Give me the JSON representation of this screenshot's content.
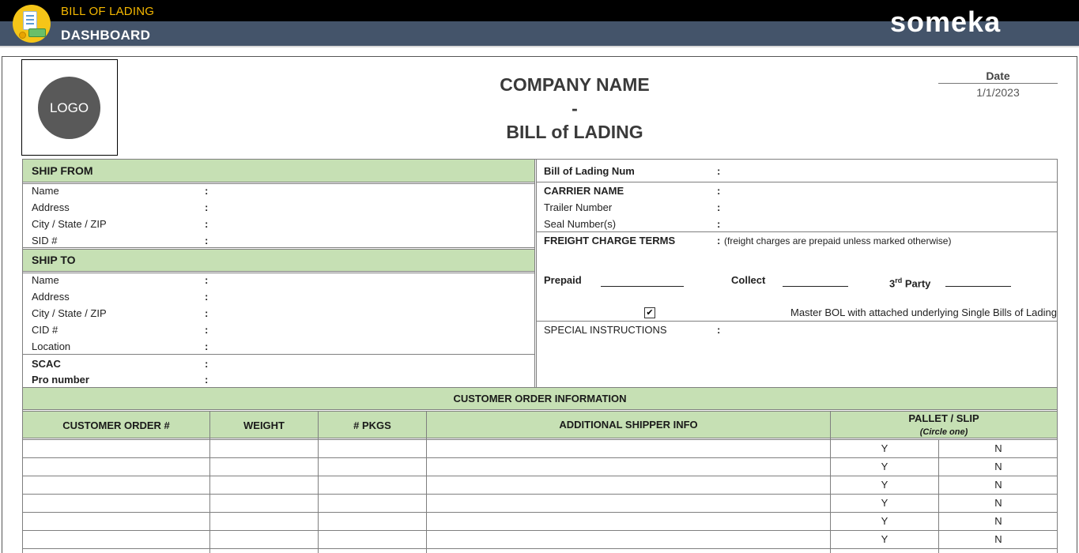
{
  "header": {
    "app_title": "BILL OF LADING",
    "section": "DASHBOARD",
    "brand": "someka"
  },
  "logo": {
    "text": "LOGO"
  },
  "document": {
    "company_name": "COMPANY NAME",
    "separator": "-",
    "doc_title": "BILL of LADING",
    "date_label": "Date",
    "date_value": "1/1/2023"
  },
  "ship_from": {
    "title": "SHIP FROM",
    "fields": [
      "Name",
      "Address",
      "City / State / ZIP",
      "SID #"
    ]
  },
  "ship_to": {
    "title": "SHIP TO",
    "fields": [
      "Name",
      "Address",
      "City / State / ZIP",
      "CID #",
      "Location"
    ],
    "scac": "SCAC",
    "pro_number": "Pro number"
  },
  "right_panel": {
    "bol_num": "Bill of Lading Num",
    "carrier_name": "CARRIER NAME",
    "trailer_number": "Trailer Number",
    "seal_numbers": "Seal Number(s)",
    "freight_terms": "FREIGHT CHARGE TERMS",
    "freight_note": "(freight charges are prepaid unless marked otherwise)",
    "prepaid": "Prepaid",
    "collect": "Collect",
    "third_party_num": "3",
    "third_party_sup": "rd",
    "third_party_word": "Party",
    "master_bol": "Master BOL with attached underlying Single Bills of Lading",
    "master_checked": "✔",
    "special_instructions": "SPECIAL INSTRUCTIONS"
  },
  "colon": ":",
  "orders": {
    "title": "CUSTOMER ORDER INFORMATION",
    "columns": [
      "CUSTOMER ORDER #",
      "WEIGHT",
      "# PKGS",
      "ADDITIONAL SHIPPER INFO",
      "PALLET / SLIP"
    ],
    "pallet_sub": "(Circle one)",
    "yes": "Y",
    "no": "N",
    "row_count": 6
  },
  "colors": {
    "header_top": "#000000",
    "header_band": "#44546a",
    "accent_yellow": "#f5b800",
    "section_green": "#c6e0b4"
  }
}
